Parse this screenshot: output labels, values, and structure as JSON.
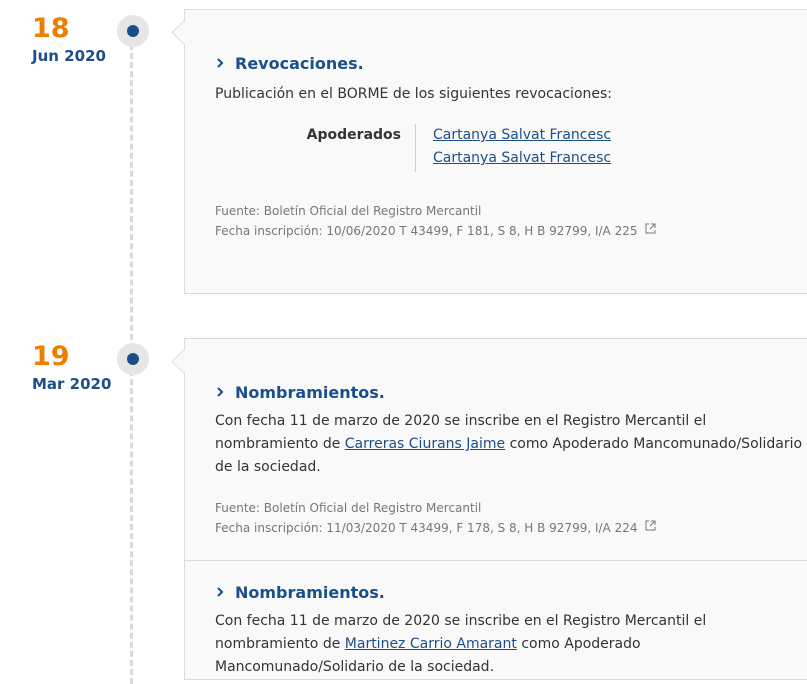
{
  "events": [
    {
      "day": "18",
      "month": "Jun 2020",
      "entries": [
        {
          "title": "Revocaciones.",
          "intro": "Publicación en el BORME de los siguientes revocaciones:",
          "role": "Apoderados",
          "names": [
            "Cartanya Salvat Francesc",
            "Cartanya Salvat Francesc"
          ],
          "source": "Fuente: Boletín Oficial del Registro Mercantil",
          "registration": "Fecha inscripción: 10/06/2020 T 43499, F 181, S 8, H B 92799, I/A 225"
        }
      ]
    },
    {
      "day": "19",
      "month": "Mar 2020",
      "entries": [
        {
          "title": "Nombramientos.",
          "text_before": "Con fecha 11 de marzo de 2020 se inscribe en el Registro Mercantil el nombramiento de ",
          "person": "Carreras Ciurans Jaime",
          "text_after": " como Apoderado Mancomunado/Solidario de la sociedad.",
          "source": "Fuente: Boletín Oficial del Registro Mercantil",
          "registration": "Fecha inscripción: 11/03/2020 T 43499, F 178, S 8, H B 92799, I/A 224"
        },
        {
          "title": "Nombramientos.",
          "text_before": "Con fecha 11 de marzo de 2020 se inscribe en el Registro Mercantil el nombramiento de ",
          "person": "Martinez Carrio Amarant",
          "text_after": " como Apoderado Mancomunado/Solidario de la sociedad."
        }
      ]
    }
  ],
  "colors": {
    "accent_orange": "#ef7d00",
    "brand_blue": "#1b4f8a",
    "card_bg": "#f9f9f9",
    "border": "#dcdcdc"
  },
  "icons": {
    "chevron": "chevron-right-icon",
    "external": "external-link-icon",
    "timeline_dot": "timeline-dot-icon"
  }
}
